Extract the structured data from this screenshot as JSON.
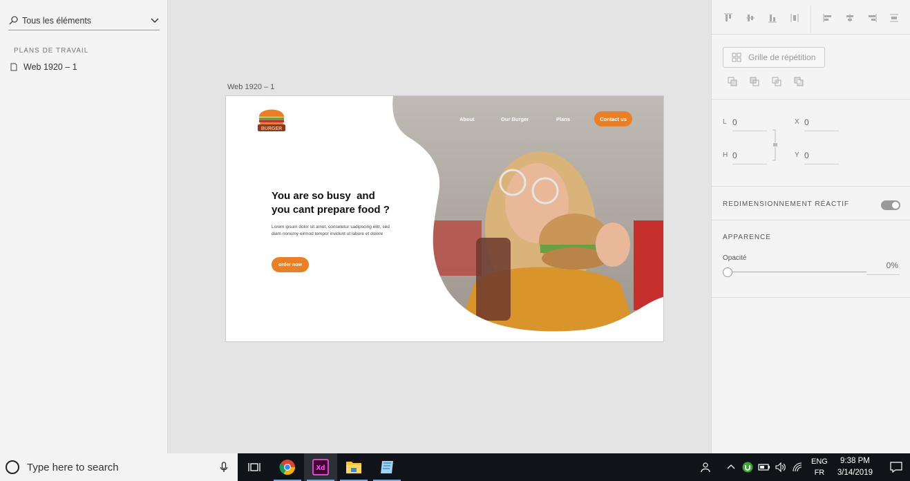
{
  "left_panel": {
    "search_label": "Tous les éléments",
    "section_title": "PLANS DE TRAVAIL",
    "artboards": [
      "Web 1920 – 1"
    ]
  },
  "canvas": {
    "artboard_label": "Web 1920 – 1",
    "design": {
      "logo_text": "BURGER",
      "nav": [
        "About",
        "Our Burger",
        "Plans"
      ],
      "contact_label": "Contact us",
      "headline_line1": "You are so busy  and",
      "headline_line2": "you cant prepare food ?",
      "lorem_line1": "Lorem ipsum dolor sit amet, consetetur sadipscing elitr, sed",
      "lorem_line2": "diam nonumy eirmod tempor invidunt ut labore et dolore",
      "order_label": "order now",
      "accent_color": "#e98027"
    }
  },
  "right_panel": {
    "grid_label": "Grille de répétition",
    "dims": {
      "l_label": "L",
      "l_value": "0",
      "x_label": "X",
      "x_value": "0",
      "h_label": "H",
      "h_value": "0",
      "y_label": "Y",
      "y_value": "0"
    },
    "responsive_label": "REDIMENSIONNEMENT RÉACTIF",
    "appearance_label": "APPARENCE",
    "opacity_label": "Opacité",
    "opacity_value": "0%"
  },
  "taskbar": {
    "search_placeholder": "Type here to search",
    "lang_top": "ENG",
    "lang_bottom": "FR",
    "time": "9:38 PM",
    "date": "3/14/2019"
  }
}
